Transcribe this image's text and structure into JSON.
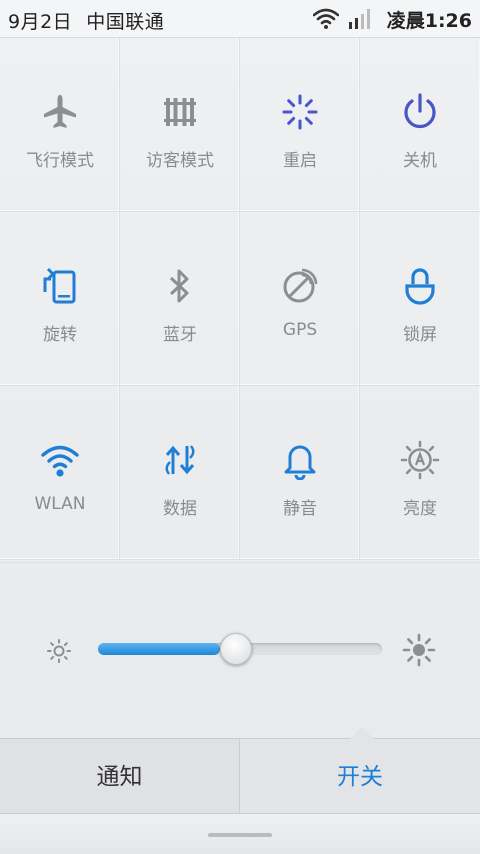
{
  "status_bar": {
    "date": "9月2日",
    "carrier": "中国联通",
    "time": "凌晨1:26"
  },
  "toggles": [
    {
      "id": "airplane",
      "label": "飞行模式",
      "icon": "airplane-icon",
      "color": "#8a8f94"
    },
    {
      "id": "guest",
      "label": "访客模式",
      "icon": "guest-mode-icon",
      "color": "#8a8f94"
    },
    {
      "id": "reboot",
      "label": "重启",
      "icon": "reboot-icon",
      "color": "#4a55c7"
    },
    {
      "id": "power",
      "label": "关机",
      "icon": "power-icon",
      "color": "#4a55c7"
    },
    {
      "id": "rotate",
      "label": "旋转",
      "icon": "rotate-icon",
      "color": "#1f7fd6"
    },
    {
      "id": "bluetooth",
      "label": "蓝牙",
      "icon": "bluetooth-icon",
      "color": "#8a8f94"
    },
    {
      "id": "gps",
      "label": "GPS",
      "icon": "gps-icon",
      "color": "#8a8f94"
    },
    {
      "id": "lock",
      "label": "锁屏",
      "icon": "lock-screen-icon",
      "color": "#1f7fd6"
    },
    {
      "id": "wlan",
      "label": "WLAN",
      "icon": "wifi-icon",
      "color": "#1f7fd6"
    },
    {
      "id": "data",
      "label": "数据",
      "icon": "mobile-data-icon",
      "color": "#1f7fd6"
    },
    {
      "id": "silent",
      "label": "静音",
      "icon": "bell-icon",
      "color": "#1f7fd6"
    },
    {
      "id": "brightness",
      "label": "亮度",
      "icon": "auto-brightness-icon",
      "color": "#8a8f94"
    }
  ],
  "brightness": {
    "level": 0.43
  },
  "tabs": {
    "notify_label": "通知",
    "switch_label": "开关",
    "active": "switch"
  }
}
